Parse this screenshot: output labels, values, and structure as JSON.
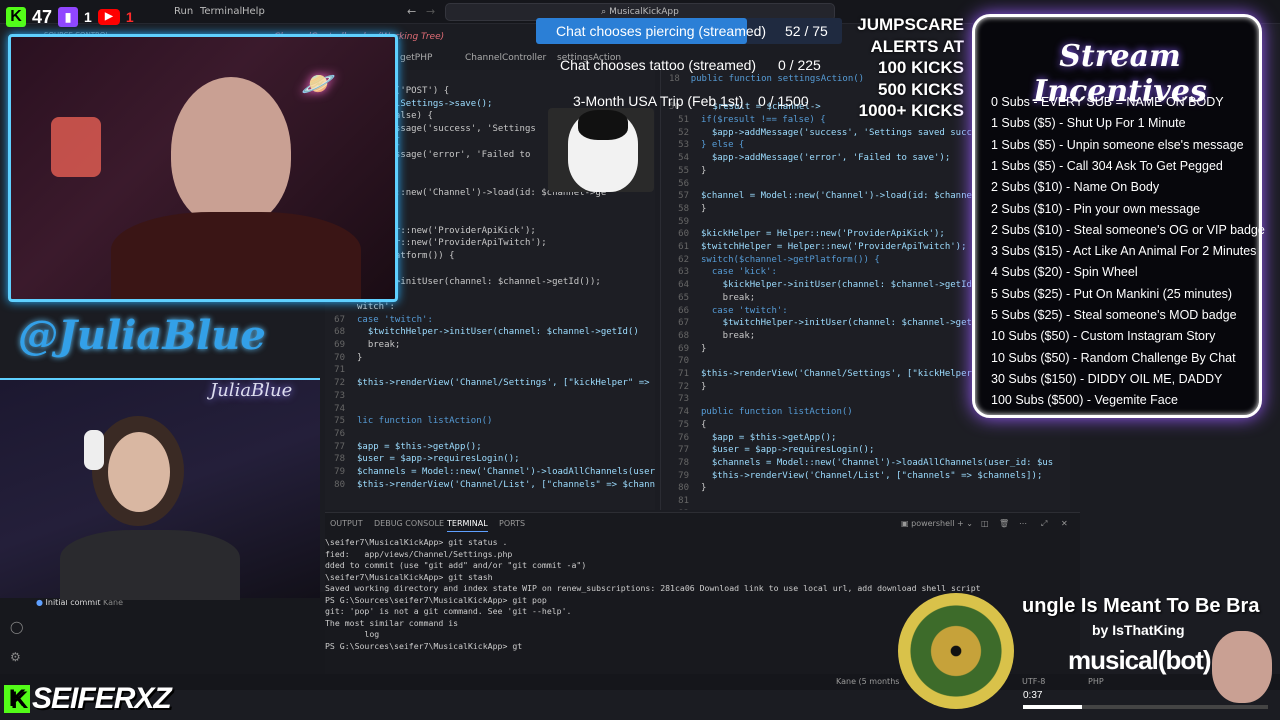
{
  "socials": {
    "kick_count": "47",
    "twitch_count": "1",
    "youtube_count": "1"
  },
  "menu": [
    "Run",
    "Terminal",
    "Help"
  ],
  "search": {
    "text": "MusicalKickApp"
  },
  "tabs": [
    "getPHP",
    "ChannelController.php (Working Tree)",
    "ChannelController",
    "settingsAction"
  ],
  "sidebar": {
    "source_control": "SOURCE CONTROL",
    "commit": "Initial commit",
    "author": "Kane",
    "branch": "renew_subscriptions"
  },
  "left_code": [
    [
      "",
      "getType('POST') {"
    ],
    [
      "",
      "$channelSettings->save();"
    ],
    [
      "",
      "t !== false) {"
    ],
    [
      "",
      "->addMessage('success', 'Settings"
    ],
    [
      "",
      "} else {"
    ],
    [
      "",
      "->addMessage('error', 'Failed to"
    ],
    [
      "",
      ""
    ],
    [
      "",
      ""
    ],
    [
      "",
      "= Model::new('Channel')->load(id: $channel->ge"
    ],
    [
      "",
      ""
    ],
    [
      "",
      ""
    ],
    [
      "",
      "= Helper::new('ProviderApiKick');"
    ],
    [
      "",
      "= Helper::new('ProviderApiTwitch');"
    ],
    [
      "",
      "->getPlatform()) {"
    ],
    [
      "",
      "ick':"
    ],
    [
      "",
      "Helper->initUser(channel: $channel->getId());"
    ],
    [
      "",
      "ak;"
    ],
    [
      "",
      "witch':"
    ],
    [
      "67",
      "case 'twitch':"
    ],
    [
      "68",
      "  $twitchHelper->initUser(channel: $channel->getId()"
    ],
    [
      "69",
      "  break;"
    ],
    [
      "70",
      "}"
    ],
    [
      "71",
      ""
    ],
    [
      "72",
      "$this->renderView('Channel/Settings', [\"kickHelper\" => $kic"
    ],
    [
      "73",
      ""
    ],
    [
      "74",
      ""
    ],
    [
      "75",
      "lic function listAction()"
    ],
    [
      "76",
      ""
    ],
    [
      "77",
      "$app = $this->getApp();"
    ],
    [
      "78",
      "$user = $app->requiresLogin();"
    ],
    [
      "79",
      "$channels = Model::new('Channel')->loadAllChannels(user_id:"
    ],
    [
      "80",
      "$this->renderView('Channel/List', [\"channels\" => $channels"
    ]
  ],
  "right_code": [
    [
      "51",
      "if($result !== false) {"
    ],
    [
      "52",
      "  $app->addMessage('success', 'Settings saved successfully');"
    ],
    [
      "53",
      "} else {"
    ],
    [
      "54",
      "  $app->addMessage('error', 'Failed to save');"
    ],
    [
      "55",
      "}"
    ],
    [
      "56",
      ""
    ],
    [
      "57",
      "$channel = Model::new('Channel')->load(id: $channel->getId());"
    ],
    [
      "58",
      "}"
    ],
    [
      "59",
      ""
    ],
    [
      "60",
      "$kickHelper = Helper::new('ProviderApiKick');"
    ],
    [
      "61",
      "$twitchHelper = Helper::new('ProviderApiTwitch');"
    ],
    [
      "62",
      "switch($channel->getPlatform()) {"
    ],
    [
      "63",
      "  case 'kick':"
    ],
    [
      "64",
      "    $kickHelper->initUser(channel: $channel->getId());"
    ],
    [
      "65",
      "    break;"
    ],
    [
      "66",
      "  case 'twitch':"
    ],
    [
      "67",
      "    $twitchHelper->initUser(channel: $channel->getId());"
    ],
    [
      "68",
      "    break;"
    ],
    [
      "69",
      "}"
    ],
    [
      "70",
      ""
    ],
    [
      "71",
      "$this->renderView('Channel/Settings', [\"kickHelper\" => $kick"
    ],
    [
      "72",
      "}"
    ],
    [
      "73",
      ""
    ],
    [
      "74",
      "public function listAction()"
    ],
    [
      "75",
      "{"
    ],
    [
      "76",
      "  $app = $this->getApp();"
    ],
    [
      "77",
      "  $user = $app->requiresLogin();"
    ],
    [
      "78",
      "  $channels = Model::new('Channel')->loadAllChannels(user_id: $us"
    ],
    [
      "79",
      "  $this->renderView('Channel/List', [\"channels\" => $channels]);"
    ],
    [
      "80",
      "}"
    ],
    [
      "81",
      ""
    ],
    [
      "82",
      ""
    ]
  ],
  "right_code_header": {
    "ln18": "18",
    "line": "public function settingsAction()",
    "ln50": "50",
    "line50": "$result = $channel->"
  },
  "panel": {
    "tabs": [
      "OUTPUT",
      "DEBUG CONSOLE",
      "TERMINAL",
      "PORTS"
    ],
    "active": "TERMINAL",
    "shell": "powershell"
  },
  "terminal": [
    "\\seifer7\\MusicalKickApp> git status .",
    "fied:   app/views/Channel/Settings.php",
    "",
    "dded to commit (use \"git add\" and/or \"git commit -a\")",
    "\\seifer7\\MusicalKickApp> git stash",
    "Saved working directory and index state WIP on renew_subscriptions: 281ca06 Download link to use local url, add download shell script",
    "PS G:\\Sources\\seifer7\\MusicalKickApp> git pop",
    "git: 'pop' is not a git command. See 'git --help'.",
    "",
    "The most similar command is",
    "        log",
    "PS G:\\Sources\\seifer7\\MusicalKickApp> gt "
  ],
  "statusbar": {
    "author": "Kane (5 months",
    "enc": "UTF-8",
    "lang": "PHP"
  },
  "goals": [
    {
      "label": "Chat chooses piercing (streamed)",
      "progress": "52 / 75",
      "fill": 0.69
    },
    {
      "label": "Chat chooses tattoo (streamed)",
      "progress": "0 / 225",
      "fill": 0
    },
    {
      "label": "3-Month USA Trip (Feb 1st)",
      "progress": "0 / 1500",
      "fill": 0
    }
  ],
  "jumpscare": [
    "JUMPSCARE",
    "ALERTS AT",
    "100 KICKS",
    "500 KICKS",
    "1000+ KICKS"
  ],
  "streamer_names": {
    "julia": "@JuliaBlue",
    "neon": "JuliaBlue",
    "seifer": "SEIFERXZ"
  },
  "incentives": {
    "title": "Stream Incentives",
    "items": [
      "0 Subs - EVERY SUB = NAME ON BODY",
      "1 Subs ($5) - Shut Up For 1 Minute",
      "1 Subs ($5) - Unpin someone else's message",
      "1 Subs ($5) - Call 304 Ask To Get Pegged",
      "2 Subs ($10) - Name On Body",
      "2 Subs ($10) - Pin your own message",
      "2 Subs ($10) - Steal someone's OG or VIP badge",
      "3 Subs ($15) - Act Like An Animal For 2 Minutes",
      "4 Subs ($20) - Spin Wheel",
      "5 Subs ($25) - Put On Mankini (25 minutes)",
      "5 Subs ($25) - Steal someone's MOD badge",
      "10 Subs ($50) - Custom Instagram Story",
      "10 Subs ($50) - Random Challenge By Chat",
      "30 Subs ($150) - DIDDY OIL ME, DADDY",
      "100 Subs ($500) - Vegemite Face"
    ]
  },
  "music": {
    "title": "ungle Is Meant To Be Bra",
    "artist": "by IsThatKing",
    "brand": "musical(bot)",
    "time": "0:37",
    "progress": 0.24
  },
  "colors": {
    "accent": "#5fd0ff",
    "goal_fill": "#2b7fd6",
    "kick": "#53fc18",
    "twitch": "#9146ff",
    "youtube": "#ff0000"
  }
}
